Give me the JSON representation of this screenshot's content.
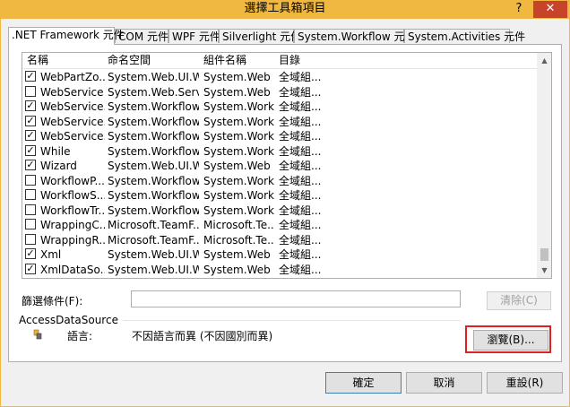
{
  "window": {
    "title": "選擇工具箱項目",
    "help_label": "?",
    "close_label": "✕"
  },
  "tabs": [
    {
      "label": ".NET Framework 元件",
      "active": true
    },
    {
      "label": "COM 元件",
      "active": false
    },
    {
      "label": "WPF 元件",
      "active": false
    },
    {
      "label": "Silverlight 元件",
      "active": false
    },
    {
      "label": "System.Workflow 元件",
      "active": false
    },
    {
      "label": "System.Activities 元件",
      "active": false
    }
  ],
  "table": {
    "columns": [
      "名稱",
      "命名空間",
      "組件名稱",
      "目錄"
    ],
    "rows": [
      {
        "checked": true,
        "name": "WebPartZo...",
        "namespace": "System.Web.UI.W...",
        "assembly": "System.Web",
        "dir": "全域組..."
      },
      {
        "checked": false,
        "name": "WebService",
        "namespace": "System.Web.Servi...",
        "assembly": "System.Web",
        "dir": "全域組..."
      },
      {
        "checked": true,
        "name": "WebService...",
        "namespace": "System.Workflow...",
        "assembly": "System.Work...",
        "dir": "全域組..."
      },
      {
        "checked": true,
        "name": "WebService...",
        "namespace": "System.Workflow...",
        "assembly": "System.Work...",
        "dir": "全域組..."
      },
      {
        "checked": true,
        "name": "WebService...",
        "namespace": "System.Workflow...",
        "assembly": "System.Work...",
        "dir": "全域組..."
      },
      {
        "checked": true,
        "name": "While",
        "namespace": "System.Workflow...",
        "assembly": "System.Work...",
        "dir": "全域組..."
      },
      {
        "checked": true,
        "name": "Wizard",
        "namespace": "System.Web.UI.W...",
        "assembly": "System.Web",
        "dir": "全域組..."
      },
      {
        "checked": false,
        "name": "WorkflowP...",
        "namespace": "System.Workflow...",
        "assembly": "System.Work...",
        "dir": "全域組..."
      },
      {
        "checked": false,
        "name": "WorkflowS...",
        "namespace": "System.Workflow...",
        "assembly": "System.Work...",
        "dir": "全域組..."
      },
      {
        "checked": false,
        "name": "WorkflowTr...",
        "namespace": "System.Workflow...",
        "assembly": "System.Work...",
        "dir": "全域組..."
      },
      {
        "checked": false,
        "name": "WrappingC...",
        "namespace": "Microsoft.TeamF...",
        "assembly": "Microsoft.Te...",
        "dir": "全域組..."
      },
      {
        "checked": false,
        "name": "WrappingR...",
        "namespace": "Microsoft.TeamF...",
        "assembly": "Microsoft.Te...",
        "dir": "全域組..."
      },
      {
        "checked": true,
        "name": "Xml",
        "namespace": "System.Web.UI.W...",
        "assembly": "System.Web",
        "dir": "全域組..."
      },
      {
        "checked": true,
        "name": "XmlDataSo...",
        "namespace": "System.Web.UI.W...",
        "assembly": "System.Web",
        "dir": "全域組..."
      }
    ]
  },
  "filter": {
    "label": "篩選條件(F):",
    "value": "",
    "clear_label": "清除(C)"
  },
  "info": {
    "component_name": "AccessDataSource",
    "language_key": "語言:",
    "language_value": "不因語言而異 (不因國別而異)"
  },
  "buttons": {
    "browse": "瀏覽(B)...",
    "ok": "確定",
    "cancel": "取消",
    "reset": "重設(R)"
  },
  "colors": {
    "title_bar": "#f0b840",
    "close_button": "#c7442b",
    "highlight": "#e02020"
  }
}
